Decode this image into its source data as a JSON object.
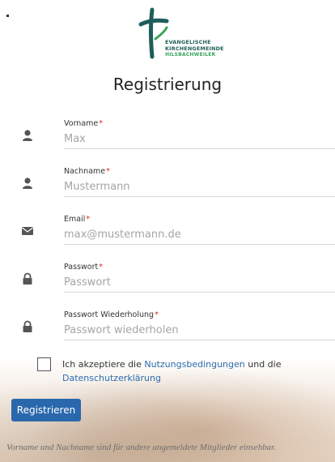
{
  "logo": {
    "line1": "EVANGELISCHE",
    "line2": "KIRCHENGEMEINDE",
    "line3": "HILSBACHWEILER"
  },
  "page": {
    "title": "Registrierung"
  },
  "form": {
    "required_mark": "*",
    "fields": [
      {
        "label": "Vorname",
        "placeholder": "Max",
        "icon": "user-icon"
      },
      {
        "label": "Nachname",
        "placeholder": "Mustermann",
        "icon": "user-icon"
      },
      {
        "label": "Email",
        "placeholder": "max@mustermann.de",
        "icon": "envelope-icon"
      },
      {
        "label": "Passwort",
        "placeholder": "Passwort",
        "icon": "lock-icon"
      },
      {
        "label": "Passwort Wiederholung",
        "placeholder": "Passwort wiederholen",
        "icon": "lock-icon"
      }
    ],
    "agree": {
      "prefix": "Ich akzeptiere die ",
      "link1": "Nutzungsbedingungen",
      "middle": " und die ",
      "link2": "Datenschutzerklärung"
    },
    "submit_label": "Registrieren",
    "note": "Vorname und Nachname sind für andere angemeldete Mitglieder einsehbar."
  },
  "colors": {
    "accent": "#2a68ad",
    "required": "#d9262d",
    "logo_dark": "#1e5d5a",
    "logo_green": "#3aa35b"
  }
}
